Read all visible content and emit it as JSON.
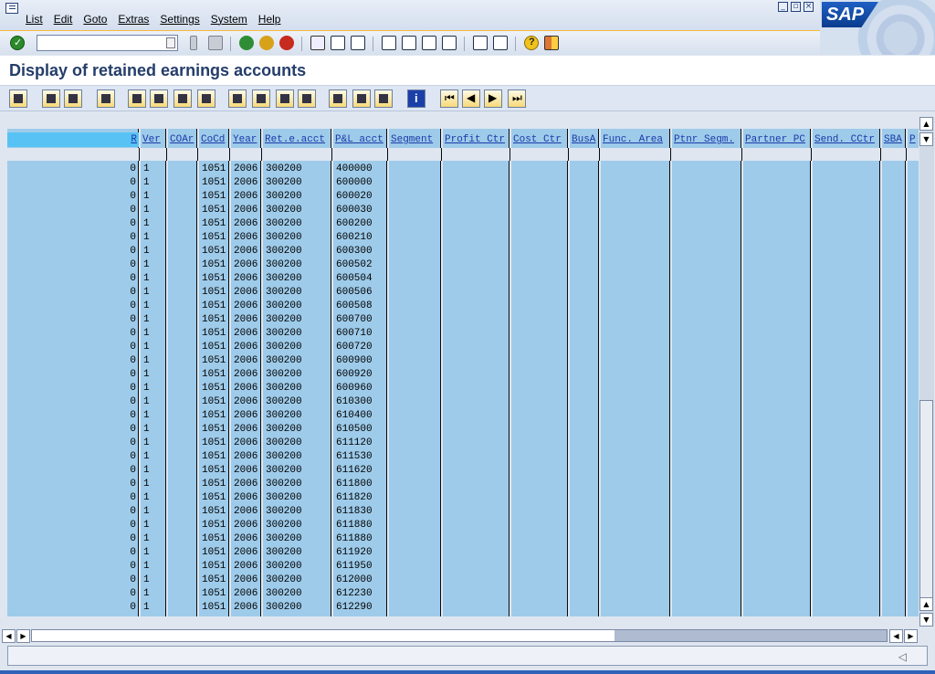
{
  "menu": [
    "List",
    "Edit",
    "Goto",
    "Extras",
    "Settings",
    "System",
    "Help"
  ],
  "brand": "SAP",
  "command_field": {
    "value": ""
  },
  "title": "Display of retained earnings accounts",
  "columns": [
    "R",
    "Ver",
    "COAr",
    "CoCd",
    "Year",
    "Ret.e.acct",
    "P&L acct",
    "Segment",
    "Profit Ctr",
    "Cost Ctr",
    "BusA",
    "Func. Area",
    "Ptnr Segm.",
    "Partner PC",
    "Send. CCtr",
    "SBA",
    "P"
  ],
  "rows": [
    [
      "0",
      "1",
      "",
      "1051",
      "2006",
      "300200",
      "400000"
    ],
    [
      "0",
      "1",
      "",
      "1051",
      "2006",
      "300200",
      "600000"
    ],
    [
      "0",
      "1",
      "",
      "1051",
      "2006",
      "300200",
      "600020"
    ],
    [
      "0",
      "1",
      "",
      "1051",
      "2006",
      "300200",
      "600030"
    ],
    [
      "0",
      "1",
      "",
      "1051",
      "2006",
      "300200",
      "600200"
    ],
    [
      "0",
      "1",
      "",
      "1051",
      "2006",
      "300200",
      "600210"
    ],
    [
      "0",
      "1",
      "",
      "1051",
      "2006",
      "300200",
      "600300"
    ],
    [
      "0",
      "1",
      "",
      "1051",
      "2006",
      "300200",
      "600502"
    ],
    [
      "0",
      "1",
      "",
      "1051",
      "2006",
      "300200",
      "600504"
    ],
    [
      "0",
      "1",
      "",
      "1051",
      "2006",
      "300200",
      "600506"
    ],
    [
      "0",
      "1",
      "",
      "1051",
      "2006",
      "300200",
      "600508"
    ],
    [
      "0",
      "1",
      "",
      "1051",
      "2006",
      "300200",
      "600700"
    ],
    [
      "0",
      "1",
      "",
      "1051",
      "2006",
      "300200",
      "600710"
    ],
    [
      "0",
      "1",
      "",
      "1051",
      "2006",
      "300200",
      "600720"
    ],
    [
      "0",
      "1",
      "",
      "1051",
      "2006",
      "300200",
      "600900"
    ],
    [
      "0",
      "1",
      "",
      "1051",
      "2006",
      "300200",
      "600920"
    ],
    [
      "0",
      "1",
      "",
      "1051",
      "2006",
      "300200",
      "600960"
    ],
    [
      "0",
      "1",
      "",
      "1051",
      "2006",
      "300200",
      "610300"
    ],
    [
      "0",
      "1",
      "",
      "1051",
      "2006",
      "300200",
      "610400"
    ],
    [
      "0",
      "1",
      "",
      "1051",
      "2006",
      "300200",
      "610500"
    ],
    [
      "0",
      "1",
      "",
      "1051",
      "2006",
      "300200",
      "611120"
    ],
    [
      "0",
      "1",
      "",
      "1051",
      "2006",
      "300200",
      "611530"
    ],
    [
      "0",
      "1",
      "",
      "1051",
      "2006",
      "300200",
      "611620"
    ],
    [
      "0",
      "1",
      "",
      "1051",
      "2006",
      "300200",
      "611800"
    ],
    [
      "0",
      "1",
      "",
      "1051",
      "2006",
      "300200",
      "611820"
    ],
    [
      "0",
      "1",
      "",
      "1051",
      "2006",
      "300200",
      "611830"
    ],
    [
      "0",
      "1",
      "",
      "1051",
      "2006",
      "300200",
      "611880"
    ],
    [
      "0",
      "1",
      "",
      "1051",
      "2006",
      "300200",
      "611880"
    ],
    [
      "0",
      "1",
      "",
      "1051",
      "2006",
      "300200",
      "611920"
    ],
    [
      "0",
      "1",
      "",
      "1051",
      "2006",
      "300200",
      "611950"
    ],
    [
      "0",
      "1",
      "",
      "1051",
      "2006",
      "300200",
      "612000"
    ],
    [
      "0",
      "1",
      "",
      "1051",
      "2006",
      "300200",
      "612230"
    ],
    [
      "0",
      "1",
      "",
      "1051",
      "2006",
      "300200",
      "612290"
    ]
  ],
  "colors": {
    "cell_bg": "#9ecbea",
    "header_selected": "#58c2f4",
    "title": "#243d6a"
  }
}
